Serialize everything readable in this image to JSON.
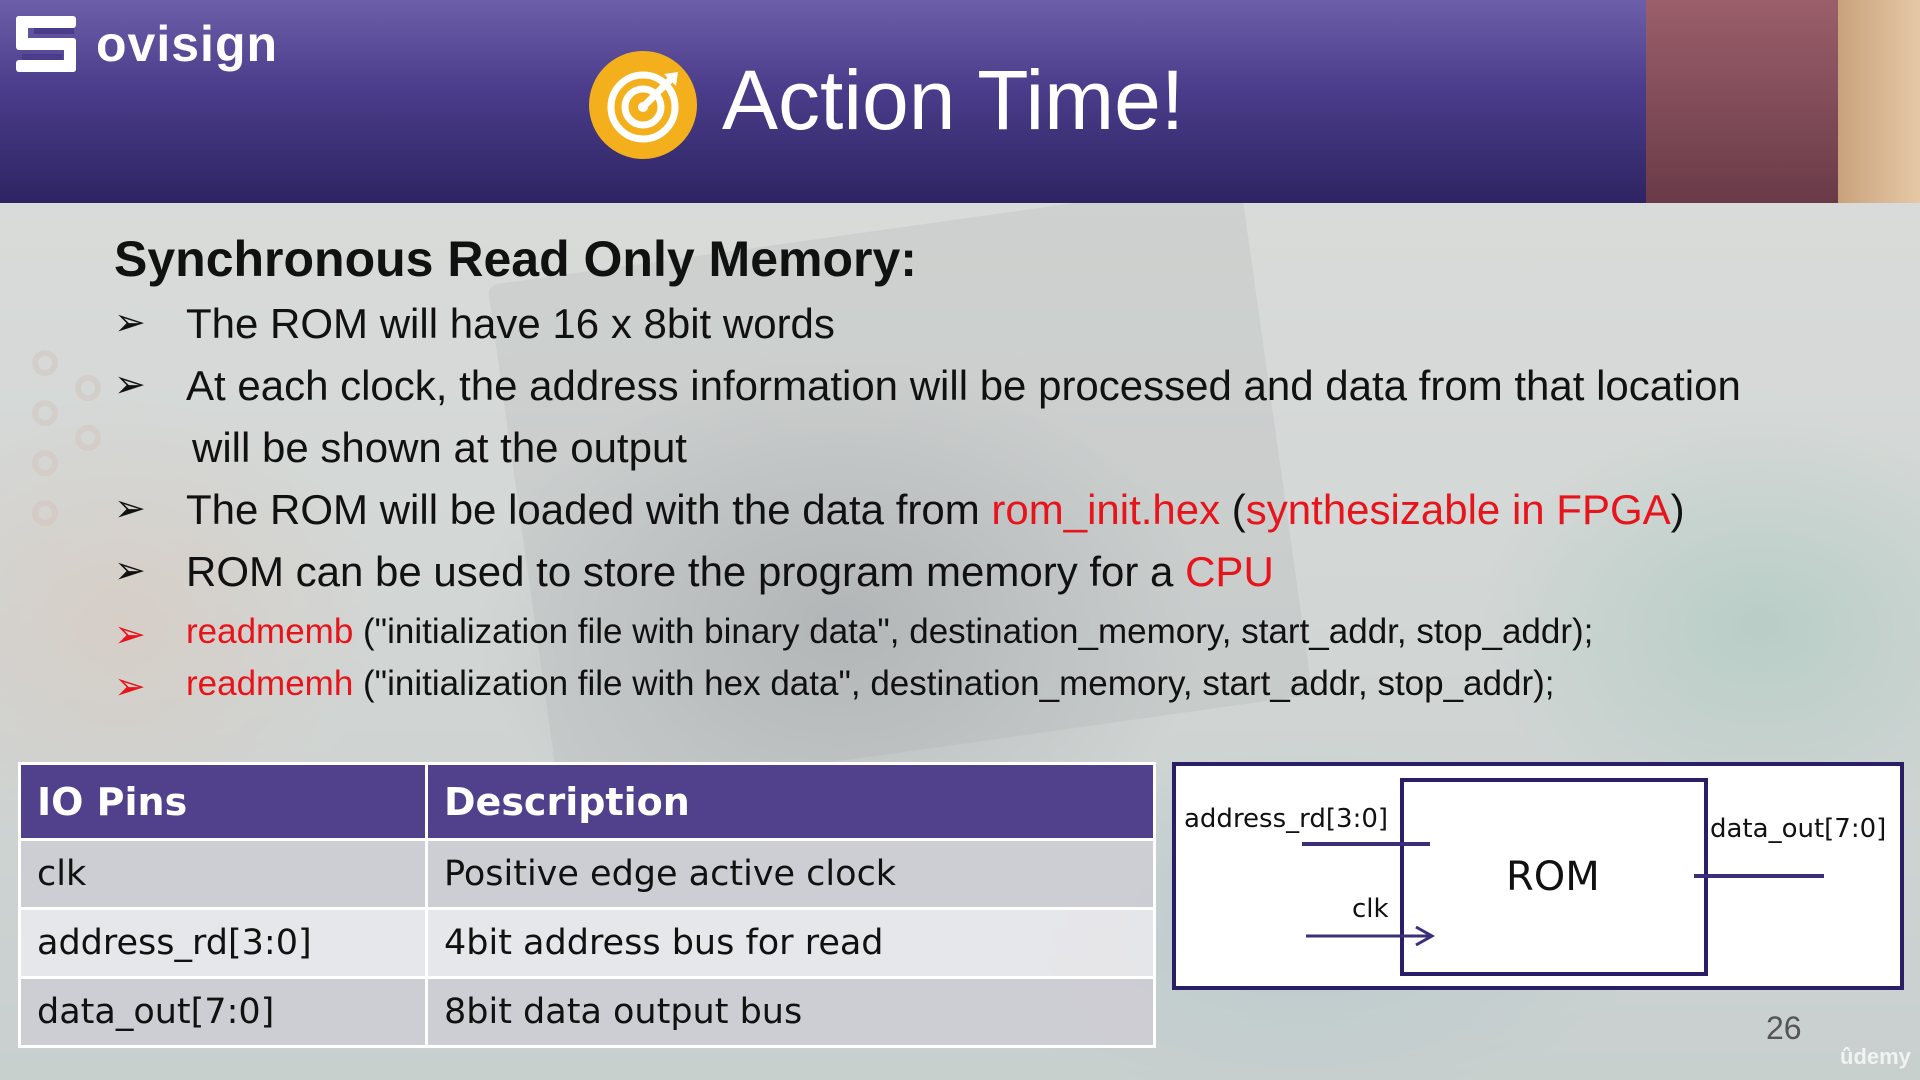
{
  "brand": {
    "logo_text": "ovisign"
  },
  "slide": {
    "title": "Action Time!",
    "heading": "Synchronous Read Only Memory:",
    "page_number": "26"
  },
  "bullets": [
    {
      "segments": [
        {
          "text": "The ROM will have 16 x 8bit words",
          "color": "#111111"
        }
      ]
    },
    {
      "segments": [
        {
          "text": "At each clock, the address information will be processed and data from that location",
          "color": "#111111"
        }
      ]
    },
    {
      "segments": [
        {
          "text": "will be shown at the output",
          "color": "#111111"
        }
      ]
    },
    {
      "segments": [
        {
          "text": "The ROM will be loaded with the data from ",
          "color": "#111111"
        },
        {
          "text": "rom_init.hex",
          "color": "#e8141b"
        },
        {
          "text": " (",
          "color": "#111111"
        },
        {
          "text": "synthesizable in FPGA",
          "color": "#e8141b"
        },
        {
          "text": ")",
          "color": "#111111"
        }
      ]
    },
    {
      "segments": [
        {
          "text": "ROM can be used to store the program memory for a ",
          "color": "#111111"
        },
        {
          "text": "CPU",
          "color": "#e8141b"
        }
      ]
    },
    {
      "segments": [
        {
          "text": "readmemb",
          "color": "#e8141b"
        },
        {
          "text": " (\"initialization file with binary data\", destination_memory, start_addr, stop_addr);",
          "color": "#111111"
        }
      ]
    },
    {
      "segments": [
        {
          "text": "readmemh",
          "color": "#e8141b"
        },
        {
          "text": " (\"initialization file with hex data\", destination_memory, start_addr, stop_addr);",
          "color": "#111111"
        }
      ]
    }
  ],
  "table": {
    "headers": [
      "IO Pins",
      "Description"
    ],
    "rows": [
      [
        "clk",
        "Positive edge active clock"
      ],
      [
        "address_rd[3:0]",
        "4bit address bus for read"
      ],
      [
        "data_out[7:0]",
        "8bit data output bus"
      ]
    ]
  },
  "diagram": {
    "block_label": "ROM",
    "input_address": "address_rd[3:0]",
    "input_clock": "clk",
    "output_data": "data_out[7:0]"
  },
  "watermark": "ûdemy",
  "colors": {
    "header": "#4a3c8a",
    "table_header": "#51418c",
    "highlight_red": "#e8141b",
    "target_icon": "#f3b01c"
  }
}
